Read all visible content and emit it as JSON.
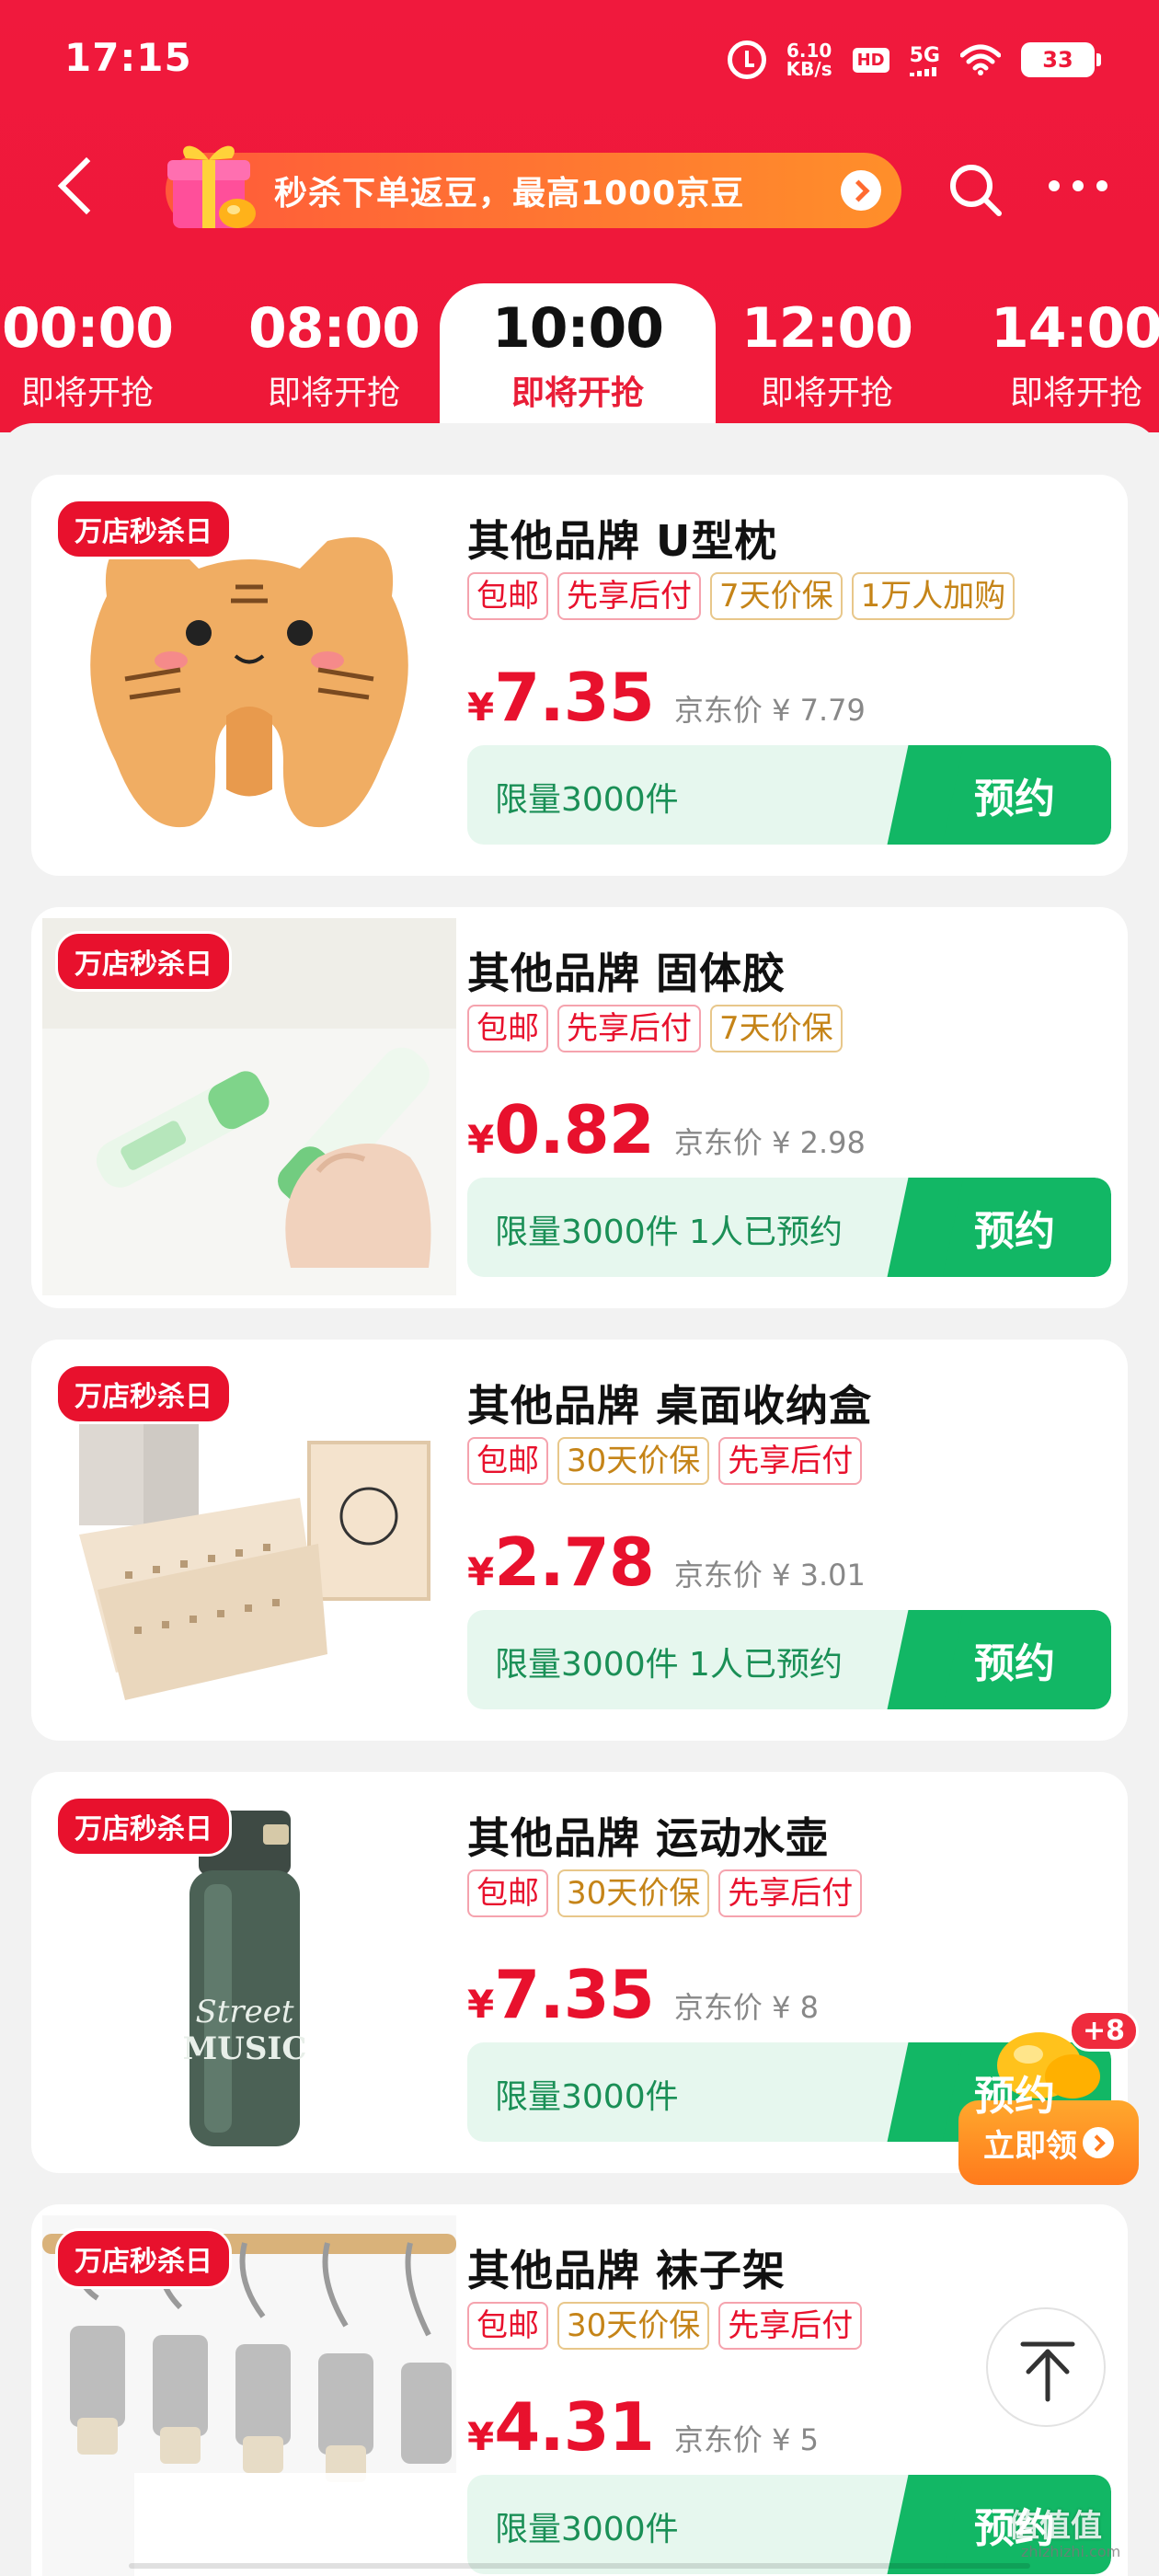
{
  "status_bar": {
    "time": "17:15",
    "net_speed_value": "6.10",
    "net_speed_unit": "KB/s",
    "hd": "HD",
    "network": "5G",
    "battery": "33"
  },
  "nav": {
    "promo_text": "秒杀下单返豆，最高1000京豆"
  },
  "tabs": [
    {
      "time": "00:00",
      "status": "即将开抢"
    },
    {
      "time": "08:00",
      "status": "即将开抢"
    },
    {
      "time": "10:00",
      "status": "即将开抢"
    },
    {
      "time": "12:00",
      "status": "即将开抢"
    },
    {
      "time": "14:00",
      "status": "即将开抢"
    }
  ],
  "products": [
    {
      "badge": "万店秒杀日",
      "title": "其他品牌 U型枕",
      "tags": [
        {
          "text": "包邮",
          "style": "red"
        },
        {
          "text": "先享后付",
          "style": "red"
        },
        {
          "text": "7天价保",
          "style": "gold"
        },
        {
          "text": "1万人加购",
          "style": "gold"
        }
      ],
      "currency": "¥",
      "price": "7.35",
      "ref_price": "京东价 ¥ 7.79",
      "limit": "限量3000件",
      "action": "预约"
    },
    {
      "badge": "万店秒杀日",
      "title": "其他品牌 固体胶",
      "tags": [
        {
          "text": "包邮",
          "style": "red"
        },
        {
          "text": "先享后付",
          "style": "red"
        },
        {
          "text": "7天价保",
          "style": "gold"
        }
      ],
      "currency": "¥",
      "price": "0.82",
      "ref_price": "京东价 ¥ 2.98",
      "limit": "限量3000件 1人已预约",
      "action": "预约"
    },
    {
      "badge": "万店秒杀日",
      "title": "其他品牌 桌面收纳盒",
      "tags": [
        {
          "text": "包邮",
          "style": "red"
        },
        {
          "text": "30天价保",
          "style": "gold"
        },
        {
          "text": "先享后付",
          "style": "red"
        }
      ],
      "currency": "¥",
      "price": "2.78",
      "ref_price": "京东价 ¥ 3.01",
      "limit": "限量3000件 1人已预约",
      "action": "预约"
    },
    {
      "badge": "万店秒杀日",
      "title": "其他品牌 运动水壶",
      "tags": [
        {
          "text": "包邮",
          "style": "red"
        },
        {
          "text": "30天价保",
          "style": "gold"
        },
        {
          "text": "先享后付",
          "style": "red"
        }
      ],
      "currency": "¥",
      "price": "7.35",
      "ref_price": "京东价 ¥ 8",
      "limit": "限量3000件",
      "action": "预约"
    },
    {
      "badge": "万店秒杀日",
      "title": "其他品牌 袜子架",
      "tags": [
        {
          "text": "包邮",
          "style": "red"
        },
        {
          "text": "30天价保",
          "style": "gold"
        },
        {
          "text": "先享后付",
          "style": "red"
        }
      ],
      "currency": "¥",
      "price": "4.31",
      "ref_price": "京东价 ¥ 5",
      "limit": "限量3000件",
      "action": "预约"
    }
  ],
  "floating": {
    "reward_count": "+8",
    "claim_label": "立即领"
  },
  "watermark": {
    "text": "值值值",
    "url": "zhizhizhi.com"
  },
  "colors": {
    "brand_red": "#ee1838",
    "price_red": "#e8112d",
    "reserve_green": "#12b765",
    "claim_orange": "#ff8a20"
  }
}
